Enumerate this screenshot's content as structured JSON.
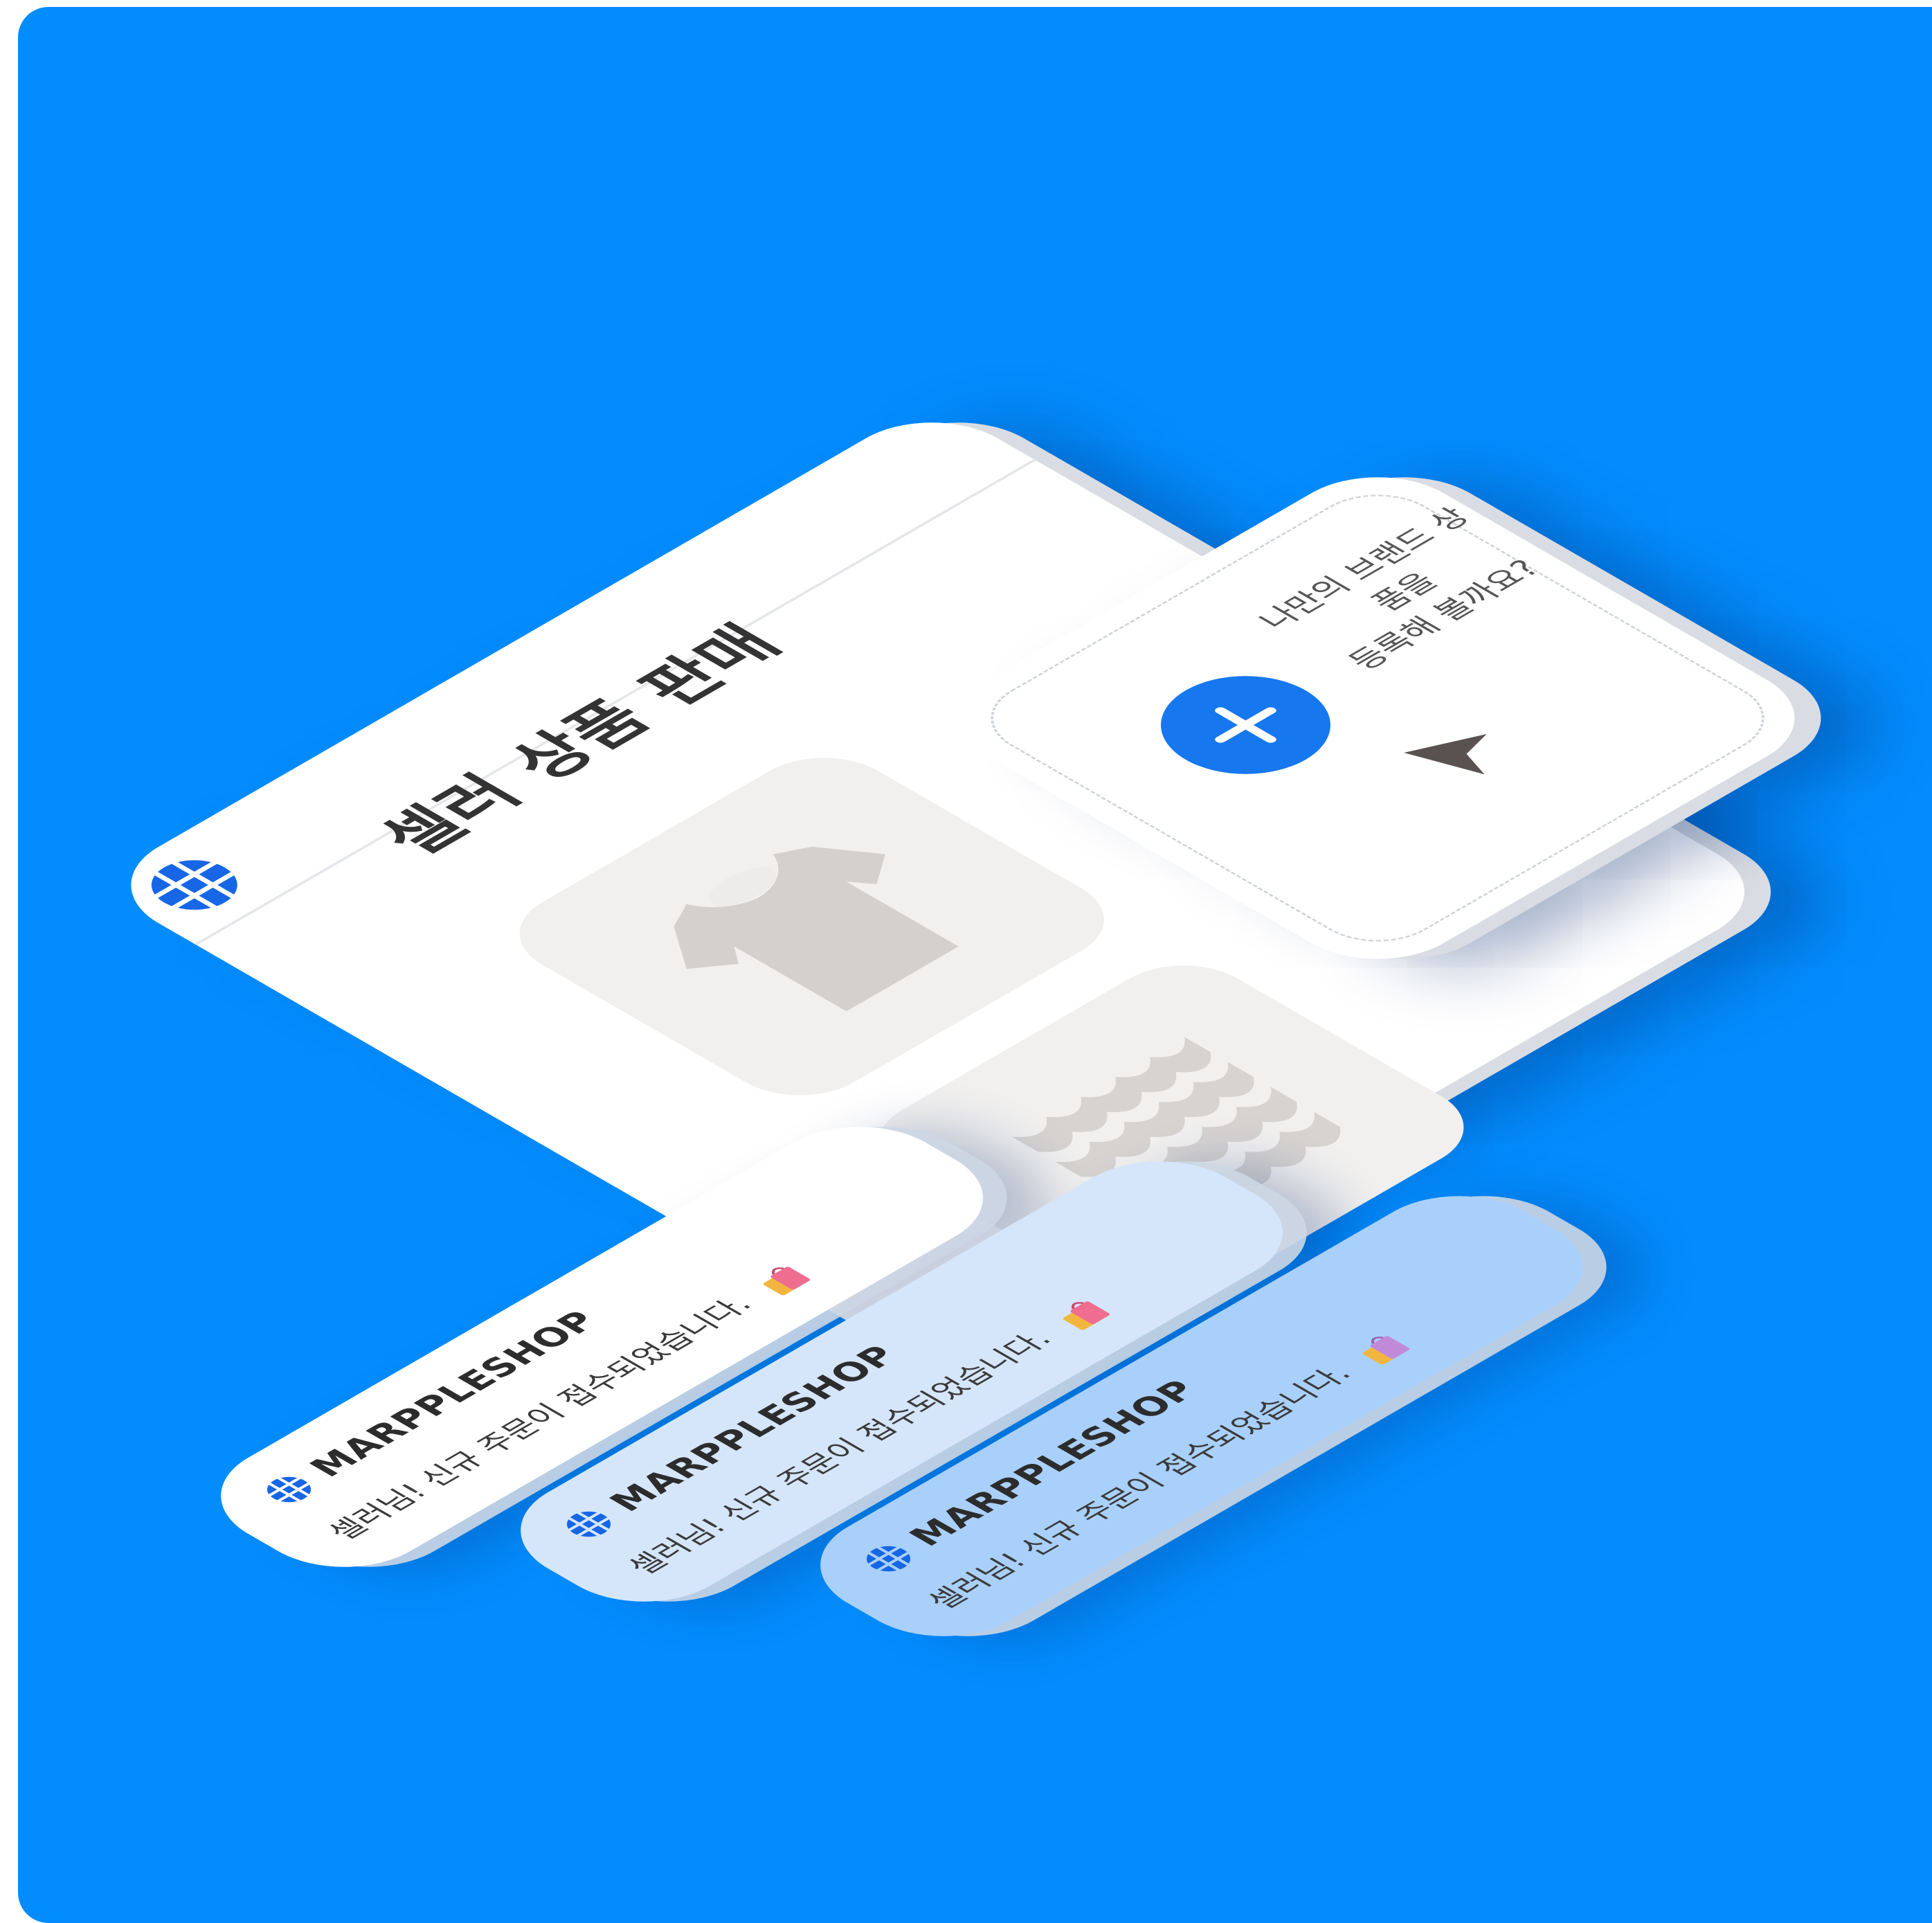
{
  "colors": {
    "background": "#038cfd",
    "accent": "#1677ee",
    "card": "#ffffff",
    "thumbnail": "#f1f0ef",
    "notification_tints": [
      "#ffffff",
      "#d5e6fb",
      "#a9d0fb"
    ]
  },
  "window": {
    "logo_icon": "globe-grid-icon",
    "title": "셀러 상품 판매",
    "products": [
      {
        "icon": "tshirt-icon"
      },
      {
        "icon": "knit-fabric-icon"
      }
    ]
  },
  "upload_card": {
    "icon": "plus-icon",
    "message_line1": "나만의 브랜드 상품을",
    "message_line2": "등록해 볼까요?",
    "cursor_icon": "pointer-cursor-icon"
  },
  "notifications": [
    {
      "brand": "MARPPLESHOP",
      "message": "셀러님! 신규 주문이 접수되었습니다.",
      "icon": "shopping-bag-icon"
    },
    {
      "brand": "MARPPLESHOP",
      "message": "셀러님! 신규 주문이 접수되었습니다.",
      "icon": "shopping-bag-icon"
    },
    {
      "brand": "MARPPLESHOP",
      "message": "셀러님! 신규 주문이 접수되었습니다.",
      "icon": "shopping-bag-icon"
    }
  ]
}
